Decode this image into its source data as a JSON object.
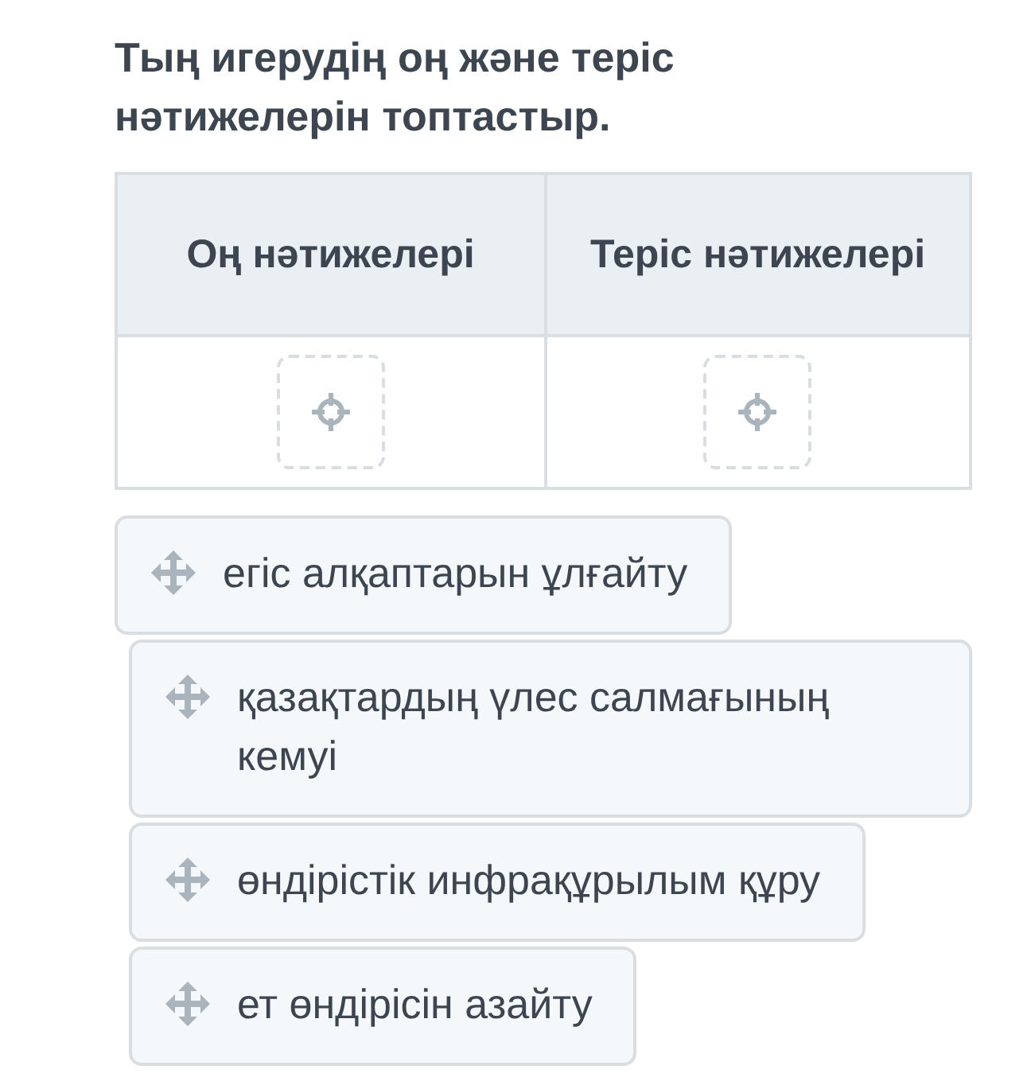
{
  "question": "Тың игерудің оң және теріс нәтижелерін топтастыр.",
  "table": {
    "columns": [
      "Оң нәтижелері",
      "Теріс нәтижелері"
    ]
  },
  "items": [
    {
      "text": "егіс алқаптарын ұлғайту"
    },
    {
      "text": "қазақтардың үлес салмағының кемуі"
    },
    {
      "text": "өндірістік инфрақұрылым құру"
    },
    {
      "text": "ет өндірісін азайту"
    }
  ]
}
